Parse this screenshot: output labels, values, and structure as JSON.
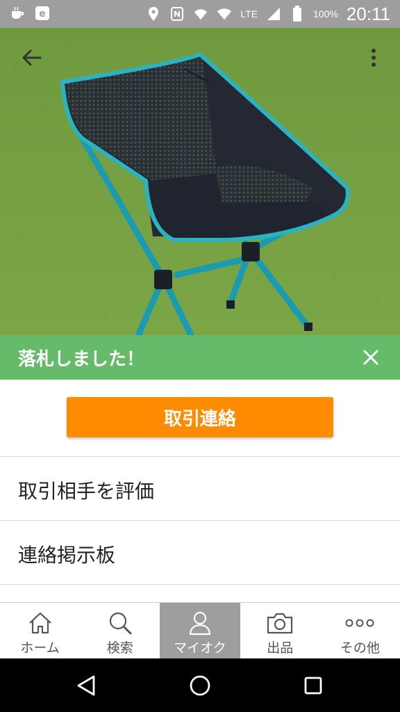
{
  "status_bar": {
    "network": "LTE",
    "battery": "100%",
    "time": "20:11"
  },
  "banner": {
    "message": "落札しました！"
  },
  "actions": {
    "contact_button": "取引連絡",
    "rate_partner": "取引相手を評価",
    "message_board": "連絡掲示板"
  },
  "bottom_nav": {
    "items": [
      {
        "label": "ホーム",
        "icon": "home-icon"
      },
      {
        "label": "検索",
        "icon": "search-icon"
      },
      {
        "label": "マイオク",
        "icon": "person-icon",
        "active": true
      },
      {
        "label": "出品",
        "icon": "camera-icon"
      },
      {
        "label": "その他",
        "icon": "more-dots-icon"
      }
    ]
  },
  "colors": {
    "banner": "#66bb6a",
    "primary_button": "#ff8c00",
    "status_bar": "#9e9e9e",
    "nav_active": "#9e9e9e"
  }
}
